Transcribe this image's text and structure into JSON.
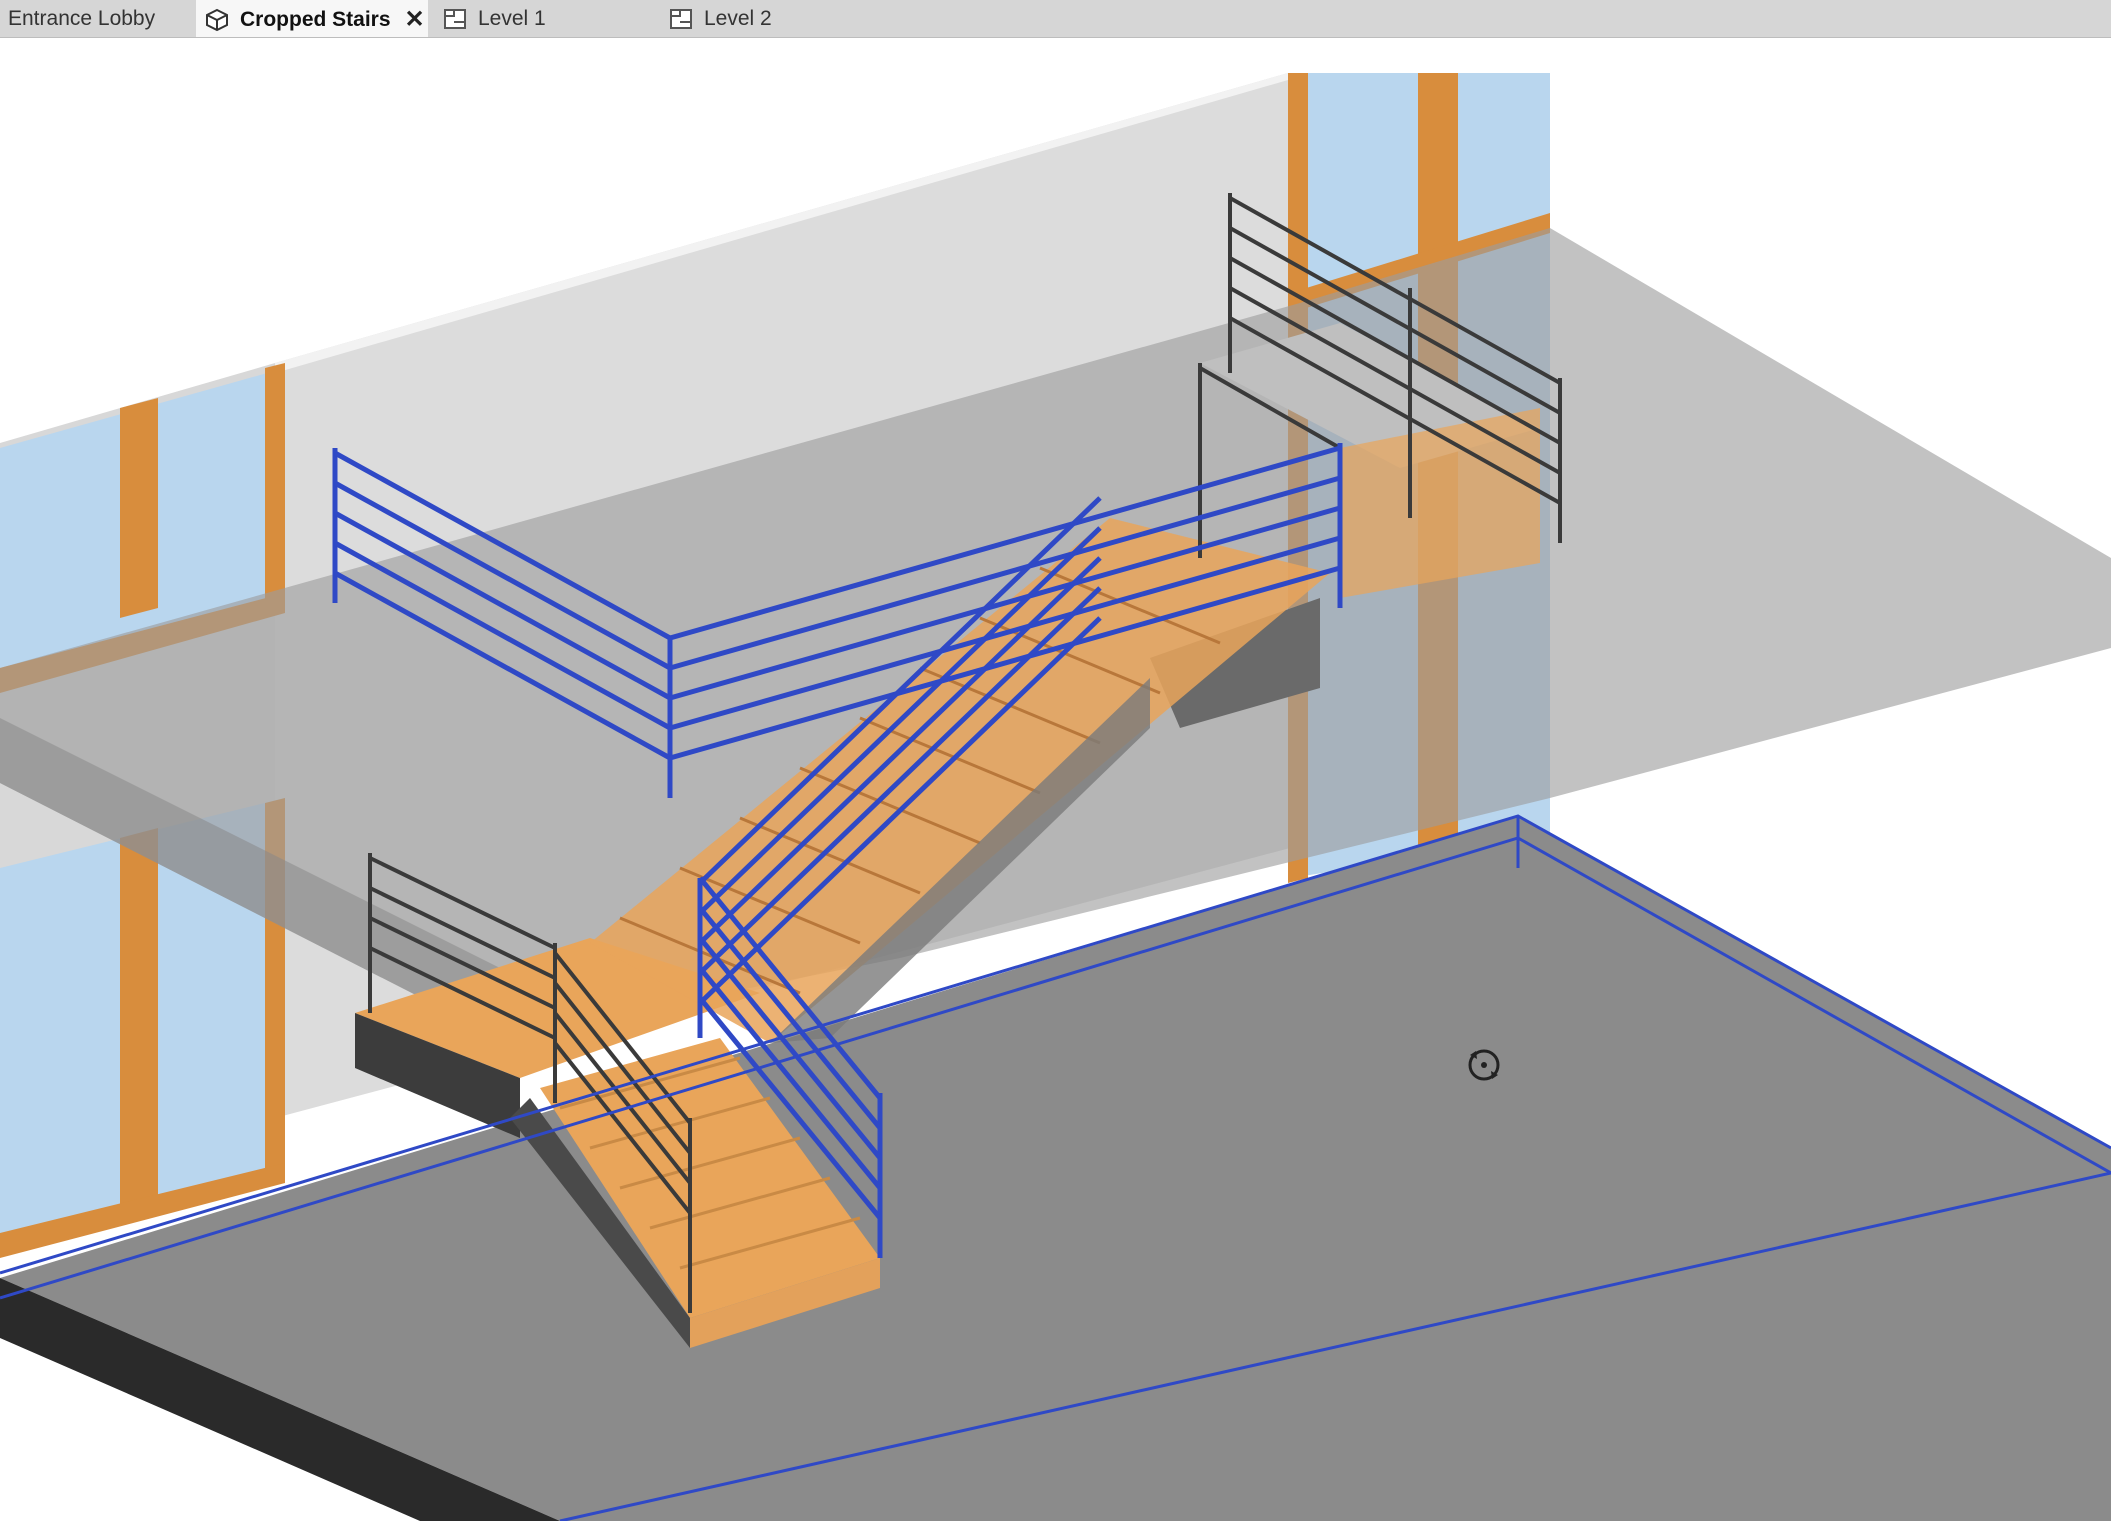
{
  "tabs": [
    {
      "label": "Entrance Lobby",
      "icon": "none",
      "active": false
    },
    {
      "label": "Cropped Stairs",
      "icon": "3d-view-icon",
      "active": true,
      "closable": true
    },
    {
      "label": "Level 1",
      "icon": "floor-plan-icon",
      "active": false
    },
    {
      "label": "Level 2",
      "icon": "floor-plan-icon",
      "active": false
    }
  ],
  "close_glyph": "✕",
  "colors": {
    "selection": "#2f49c6",
    "railing": "#3a3a3a",
    "tread": "#e9a55a",
    "wood_frame": "#d88d3d",
    "glass": "#b9d6ee",
    "floor": "#8b8b8b",
    "slab": "#b7b7b7",
    "wall": "#dcdcdc"
  },
  "cursor": "orbit-icon"
}
